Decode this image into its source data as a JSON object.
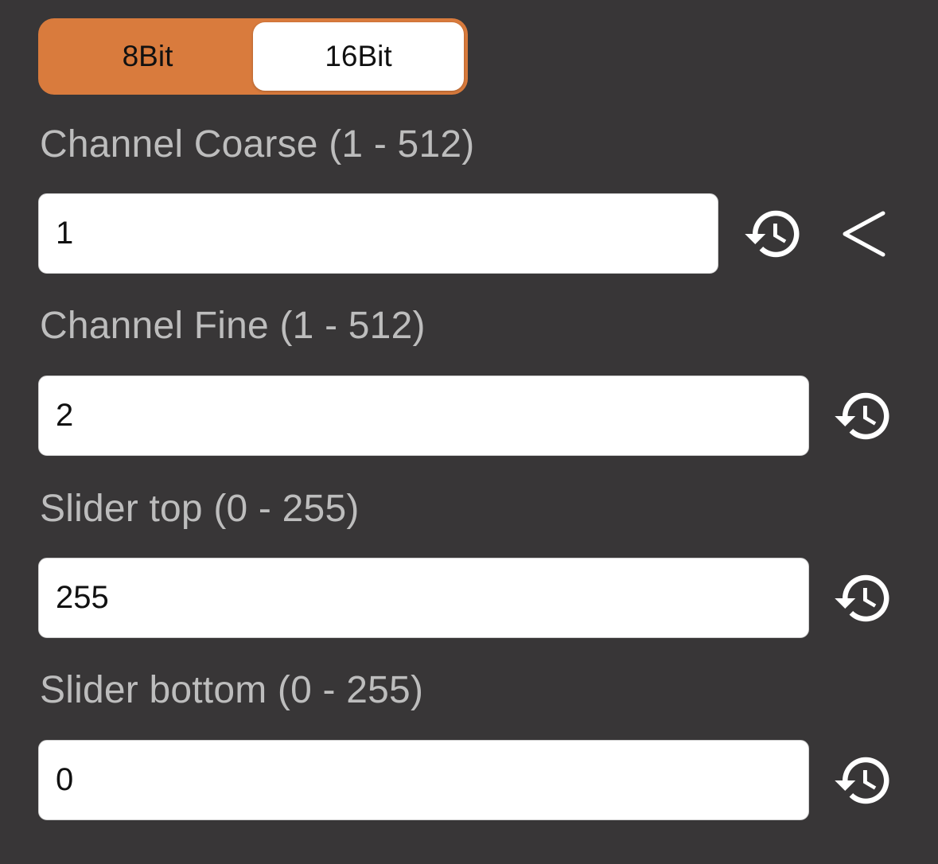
{
  "bit_mode": {
    "options": [
      "8Bit",
      "16Bit"
    ],
    "selected": "16Bit",
    "accent_color": "#d97b3d"
  },
  "fields": [
    {
      "label": "Channel Coarse (1 - 512)",
      "value": "1",
      "icon": "history-icon"
    },
    {
      "label": "Channel Fine (1 - 512)",
      "value": "2",
      "icon": "history-icon"
    },
    {
      "label": "Slider top (0 - 255)",
      "value": "255",
      "icon": "history-icon"
    },
    {
      "label": "Slider bottom (0 - 255)",
      "value": "0",
      "icon": "history-icon"
    }
  ],
  "collapse_icon": "chevron-left-icon",
  "colors": {
    "background": "#383637",
    "label_text": "#bdbdbd",
    "field_background": "#ffffff",
    "icon": "#ffffff"
  }
}
